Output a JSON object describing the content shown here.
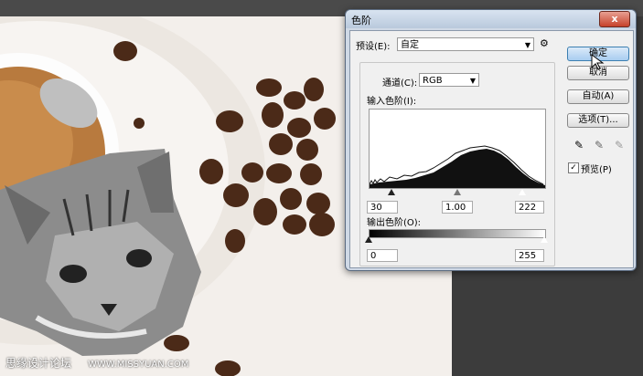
{
  "dialog": {
    "title": "色阶",
    "close_label": "x",
    "preset_label": "预设(E):",
    "preset_value": "自定",
    "channel_label": "通道(C):",
    "channel_value": "RGB",
    "input_levels_label": "输入色阶(I):",
    "input_values": {
      "black": "30",
      "mid": "1.00",
      "white": "222"
    },
    "output_levels_label": "输出色阶(O):",
    "output_values": {
      "black": "0",
      "white": "255"
    },
    "buttons": {
      "ok": "确定",
      "cancel": "取消",
      "auto": "自动(A)",
      "options": "选项(T)..."
    },
    "preview_label": "预览(P)",
    "preview_checked": true
  },
  "watermark": {
    "text": "思缘设计论坛",
    "url": "WWW.MISSYUAN.COM"
  },
  "colors": {
    "accent": "#a8cdf0",
    "close": "#c6412a"
  }
}
